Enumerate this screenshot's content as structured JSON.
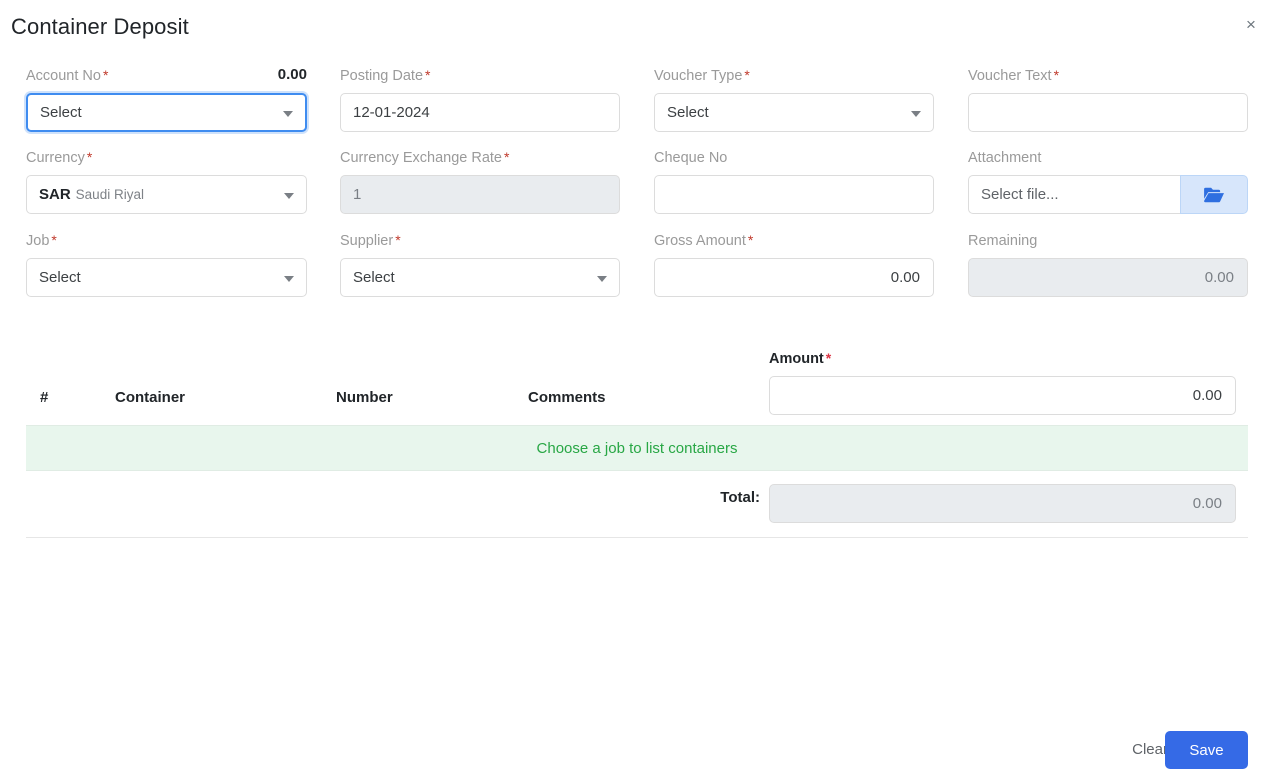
{
  "header": {
    "title": "Container Deposit",
    "close_label": "×"
  },
  "form": {
    "account_no": {
      "label": "Account No",
      "required": "*",
      "value": "Select",
      "balance": "0.00"
    },
    "posting_date": {
      "label": "Posting Date",
      "required": "*",
      "value": "12-01-2024"
    },
    "voucher_type": {
      "label": "Voucher Type",
      "required": "*",
      "value": "Select"
    },
    "voucher_text": {
      "label": "Voucher Text",
      "required": "*",
      "value": ""
    },
    "currency": {
      "label": "Currency",
      "required": "*",
      "code": "SAR",
      "name": "Saudi Riyal"
    },
    "currency_exchange_rate": {
      "label": "Currency Exchange Rate",
      "required": "*",
      "value": "1"
    },
    "cheque_no": {
      "label": "Cheque No",
      "required": "",
      "value": ""
    },
    "attachment": {
      "label": "Attachment",
      "required": "",
      "value": "Select file...",
      "browse_icon": "folder-open-icon"
    },
    "job": {
      "label": "Job",
      "required": "*",
      "value": "Select"
    },
    "supplier": {
      "label": "Supplier",
      "required": "*",
      "value": "Select"
    },
    "gross_amount": {
      "label": "Gross Amount",
      "required": "*",
      "value": "0.00"
    },
    "remaining": {
      "label": "Remaining",
      "required": "",
      "value": "0.00"
    },
    "amount": {
      "label": "Amount",
      "required": "*",
      "value": "0.00"
    }
  },
  "table": {
    "columns": [
      "#",
      "Container",
      "Number",
      "Comments"
    ],
    "empty_message": "Choose a job to list containers",
    "total_label": "Total:",
    "total_value": "0.00"
  },
  "footer": {
    "clear_label": "Clear",
    "save_label": "Save"
  },
  "colors": {
    "accent": "#356ae6",
    "focus_ring": "#3f8cf0",
    "required": "#c0392b",
    "success_bg": "#e8f6ed",
    "success_text": "#28a745",
    "disabled_bg": "#e9ecef"
  }
}
